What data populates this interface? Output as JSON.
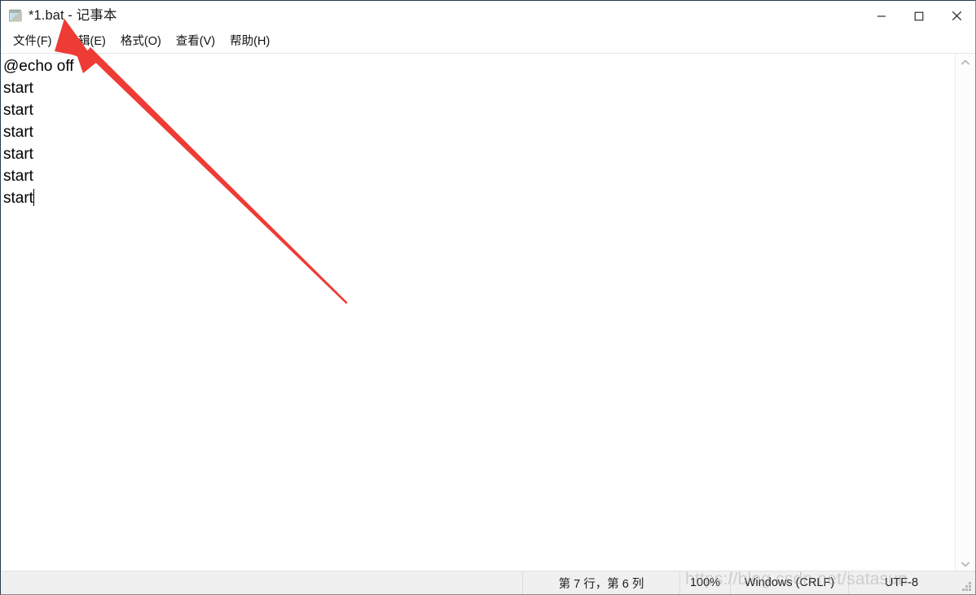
{
  "window": {
    "title": "*1.bat - 记事本",
    "icon": "notepad-icon",
    "minimize_label": "—",
    "maximize_label": "□",
    "close_label": "✕"
  },
  "menubar": {
    "items": [
      {
        "label": "文件(F)"
      },
      {
        "label": "编辑(E)"
      },
      {
        "label": "格式(O)"
      },
      {
        "label": "查看(V)"
      },
      {
        "label": "帮助(H)"
      }
    ]
  },
  "editor": {
    "lines": [
      "@echo off",
      "start",
      "start",
      "start",
      "start",
      "start",
      "start"
    ],
    "caret_line_index": 6
  },
  "scrollbar": {
    "up_arrow": "chevron-up-icon",
    "down_arrow": "chevron-down-icon"
  },
  "statusbar": {
    "position": "第 7 行，第 6 列",
    "zoom": "100%",
    "line_ending": "Windows (CRLF)",
    "encoding": "UTF-8"
  },
  "watermark": {
    "text": "https://blog.csdn.net/satasun"
  },
  "annotation": {
    "arrow_color": "#ef3b35",
    "description": "red-arrow-pointing-to-title"
  }
}
